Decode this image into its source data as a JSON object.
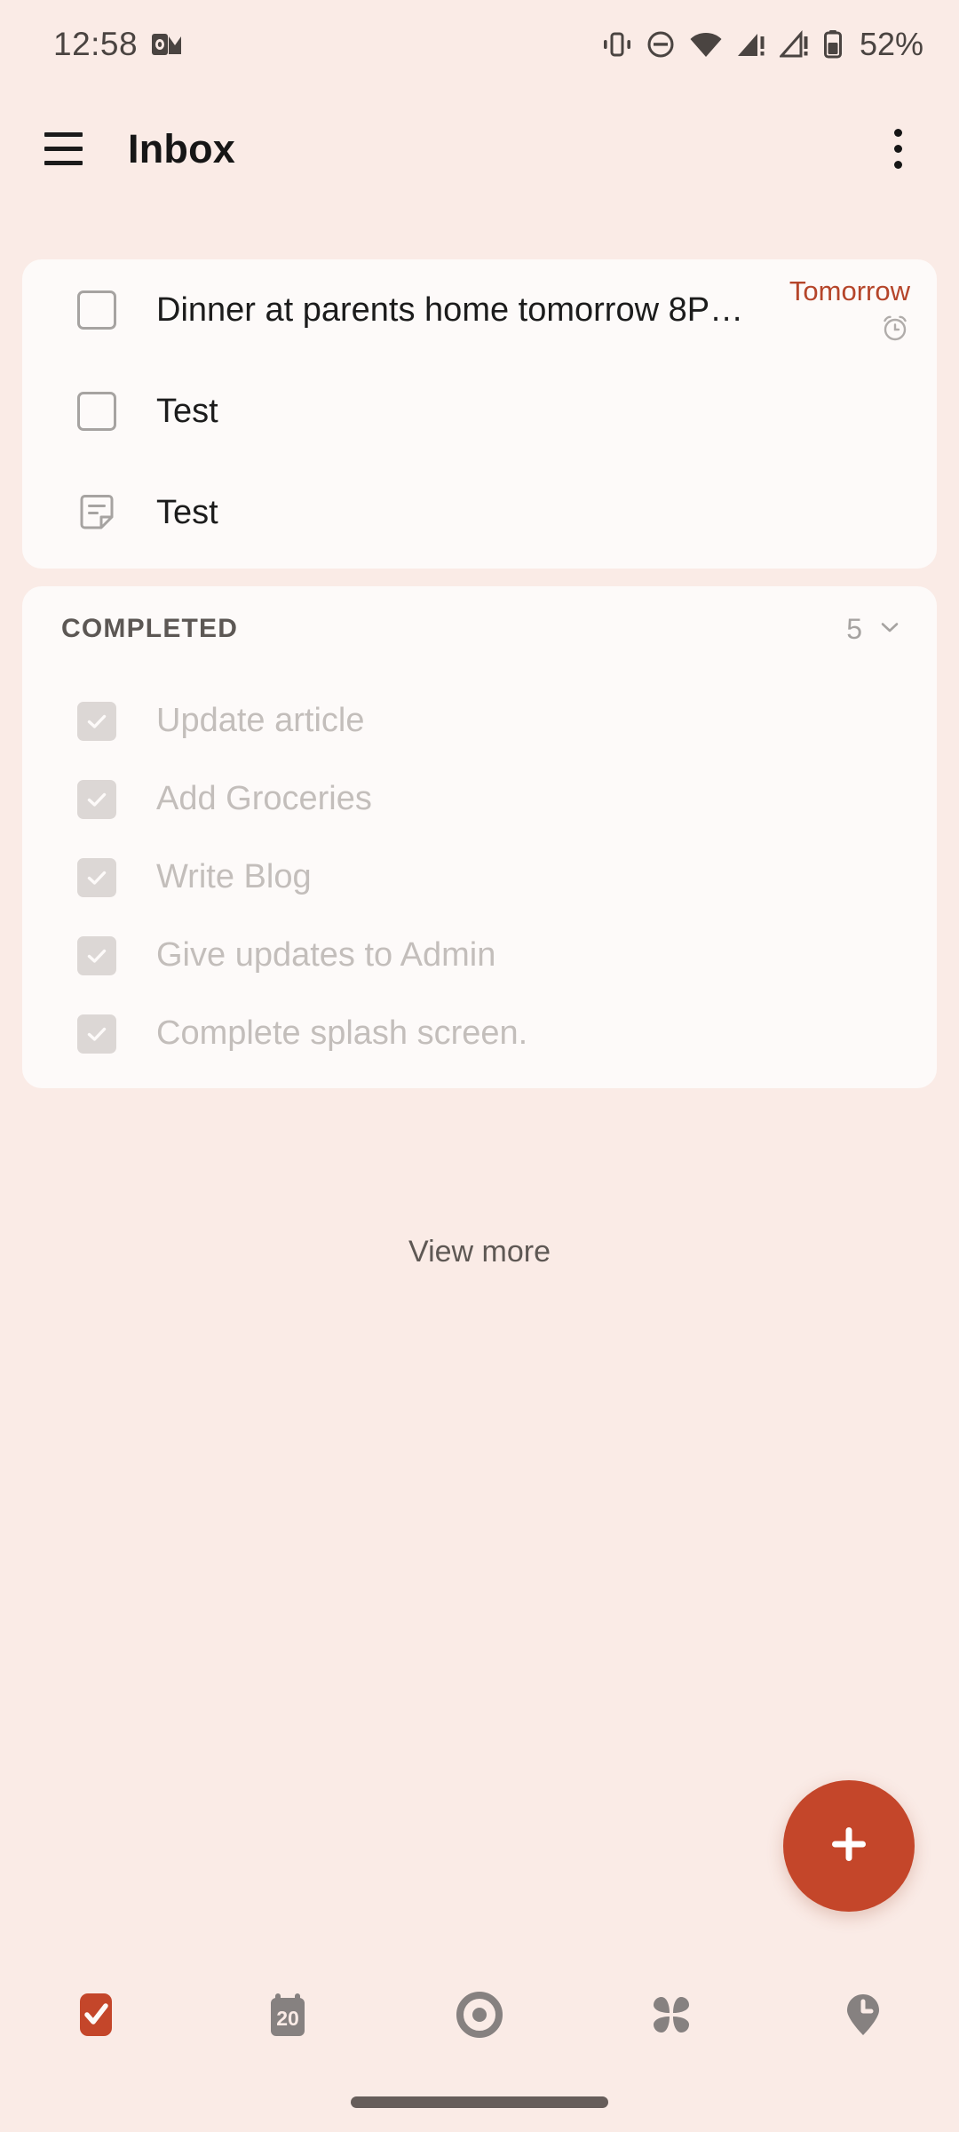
{
  "status_bar": {
    "time": "12:58",
    "battery_percent": "52%",
    "icons": [
      "outlook-icon",
      "vibrate-icon",
      "do-not-disturb-icon",
      "wifi-icon",
      "signal-sim1-icon",
      "signal-sim2-icon",
      "battery-icon"
    ]
  },
  "app_bar": {
    "menu_icon": "hamburger-menu-icon",
    "title": "Inbox",
    "overflow_icon": "overflow-menu-icon"
  },
  "colors": {
    "background": "#FAEBE6",
    "card": "#FDFAF9",
    "accent": "#C4462A",
    "due_text": "#B5452A",
    "muted_text": "#C3BEBB"
  },
  "active_tasks": [
    {
      "title": "Dinner at parents home tomorrow 8P…",
      "leading_icon": "checkbox-unchecked-icon",
      "due": "Tomorrow",
      "has_reminder": true
    },
    {
      "title": "Test",
      "leading_icon": "checkbox-unchecked-icon",
      "due": "",
      "has_reminder": false
    },
    {
      "title": "Test",
      "leading_icon": "note-icon",
      "due": "",
      "has_reminder": false
    }
  ],
  "completed_section": {
    "label": "COMPLETED",
    "count": "5",
    "chevron_icon": "chevron-down-icon",
    "items": [
      {
        "title": "Update article"
      },
      {
        "title": "Add Groceries"
      },
      {
        "title": "Write Blog"
      },
      {
        "title": "Give updates to Admin"
      },
      {
        "title": "Complete splash screen."
      }
    ]
  },
  "view_more_label": "View more",
  "fab": {
    "icon": "plus-icon",
    "label": "+"
  },
  "bottom_nav": [
    {
      "icon": "tasks-check-icon",
      "active": true
    },
    {
      "icon": "calendar-icon",
      "day": "20",
      "active": false
    },
    {
      "icon": "focus-target-icon",
      "active": false
    },
    {
      "icon": "grid-apps-icon",
      "active": false
    },
    {
      "icon": "pin-clock-icon",
      "active": false
    }
  ]
}
